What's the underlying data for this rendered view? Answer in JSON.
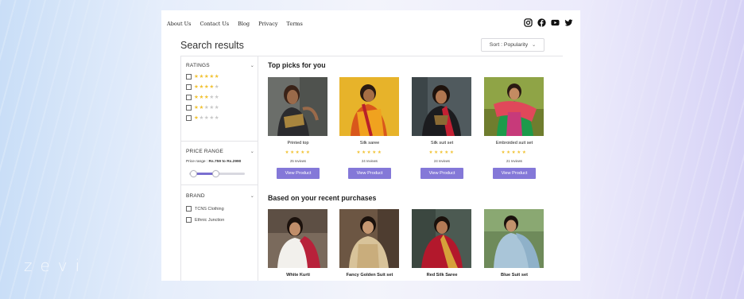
{
  "watermark": "zevi",
  "nav": {
    "links": [
      "About Us",
      "Contact Us",
      "Blog",
      "Privacy",
      "Terms"
    ]
  },
  "socials": [
    "instagram-icon",
    "facebook-icon",
    "youtube-icon",
    "twitter-icon"
  ],
  "page_title": "Search results",
  "sort": {
    "label": "Sort : Popularity"
  },
  "filters": {
    "ratings": {
      "title": "RATINGS",
      "rows": [
        5,
        4,
        3,
        2,
        1
      ]
    },
    "price": {
      "title": "PRICE RANGE",
      "label_prefix": "Price range : ",
      "label_value": "Rs.759 to Rs.2990",
      "fill_start": 0.08,
      "fill_end": 0.48
    },
    "brand": {
      "title": "BRAND",
      "items": [
        "TCNS Clothing",
        "Ethnic Junction"
      ]
    }
  },
  "sections": {
    "top_picks": {
      "title": "Top picks for you",
      "products": [
        {
          "name": "Printed top",
          "rating": 5,
          "reviews": "25 reviews",
          "button": "View Product"
        },
        {
          "name": "Silk saree",
          "rating": 5,
          "reviews": "24 reviews",
          "button": "View Product"
        },
        {
          "name": "Silk suit set",
          "rating": 5,
          "reviews": "24 reviews",
          "button": "View Product"
        },
        {
          "name": "Embroided suit set",
          "rating": 5,
          "reviews": "21 reviews",
          "button": "View Product"
        }
      ]
    },
    "recent": {
      "title": "Based on your recent purchases",
      "products": [
        {
          "name": "White Kurti"
        },
        {
          "name": "Fancy Golden Suit set"
        },
        {
          "name": "Red Silk Saree"
        },
        {
          "name": "Blue Suit set"
        }
      ]
    }
  },
  "colors": {
    "accent": "#8478d8",
    "star": "#f1c232",
    "star_empty": "#c8c8c8"
  }
}
